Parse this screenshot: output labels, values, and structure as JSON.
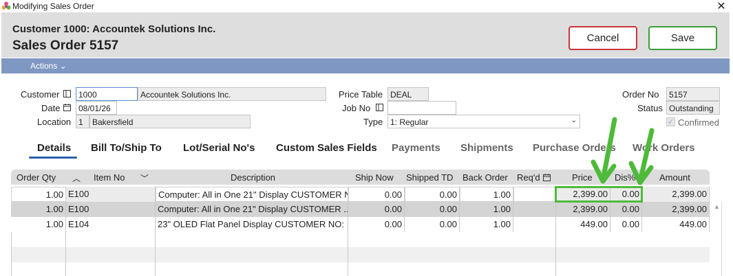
{
  "window": {
    "title": "Modifying Sales Order"
  },
  "header": {
    "customer_title": "Customer 1000: Accountek Solutions Inc.",
    "order_title": "Sales Order 5157",
    "cancel_label": "Cancel",
    "save_label": "Save",
    "actions_label": "Actions ⌄"
  },
  "form": {
    "customer_label": "Customer",
    "customer_id": "1000",
    "customer_name": "Accountek Solutions Inc.",
    "date_label": "Date",
    "date_value": "08/01/26",
    "location_label": "Location",
    "location_id": "1",
    "location_name": "Bakersfield",
    "price_table_label": "Price Table",
    "price_table_value": "DEAL",
    "job_no_label": "Job No",
    "job_no_value": "",
    "type_label": "Type",
    "type_value": "1: Regular",
    "order_no_label": "Order No",
    "order_no_value": "5157",
    "status_label": "Status",
    "status_value": "Outstanding",
    "confirmed_label": "Confirmed",
    "confirmed_checked": true
  },
  "tabs": [
    {
      "label": "Details"
    },
    {
      "label": "Bill To/Ship To"
    },
    {
      "label": "Lot/Serial No's"
    },
    {
      "label": "Custom Sales Fields"
    },
    {
      "label": "Payments"
    },
    {
      "label": "Shipments"
    },
    {
      "label": "Purchase Orders"
    },
    {
      "label": "Work Orders"
    }
  ],
  "grid": {
    "columns": [
      "Order Qty",
      "Item No",
      "Description",
      "Ship Now",
      "Shipped TD",
      "Back Order",
      "Req'd",
      "Price",
      "Dis%",
      "Amount"
    ],
    "rows": [
      [
        "1.00",
        "E100",
        "Computer: All in One 21\" Display CUSTOMER N",
        "0.00",
        "0.00",
        "1.00",
        "",
        "2,399.00",
        "0.00",
        "2,399.00"
      ],
      [
        "1.00",
        "E100",
        "Computer: All in One 21\" Display CUSTOMER ...",
        "0.00",
        "0.00",
        "1.00",
        "",
        "2,399.00",
        "0.00",
        "2,399.00"
      ],
      [
        "1.00",
        "E104",
        "23\" OLED Flat Panel Display CUSTOMER NO: ...",
        "0.00",
        "0.00",
        "1.00",
        "",
        "449.00",
        "0.00",
        "449.00"
      ]
    ]
  },
  "colors": {
    "actions_bar": "#7f97c3",
    "highlight": "#4fba3a",
    "cancel_border": "#c9343a",
    "save_border": "#3c9d3c"
  },
  "icons": [
    "app-logo-icon",
    "close-icon",
    "lookup-icon",
    "calendar-icon",
    "chevron-down-icon",
    "sort-up-icon",
    "checkmark-icon",
    "green-arrow-icon"
  ]
}
